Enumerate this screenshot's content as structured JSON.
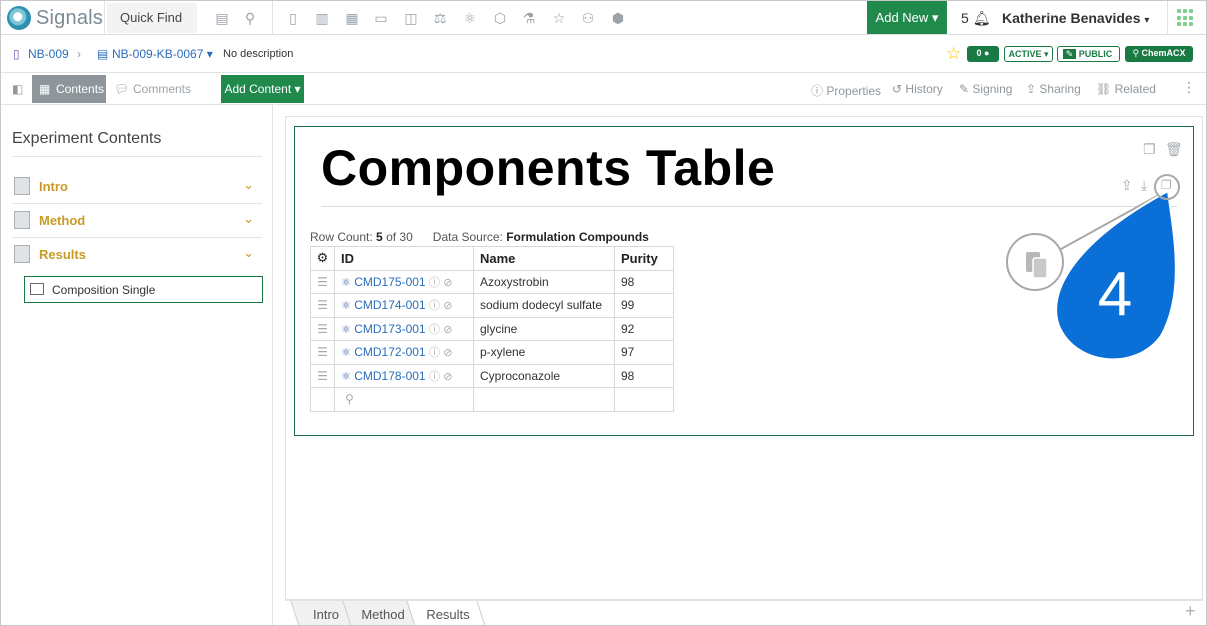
{
  "topbar": {
    "app_name": "Signals",
    "quick_find": "Quick Find",
    "add_new": "Add New",
    "notification_count": "5",
    "user_name": "Katherine Benavides"
  },
  "breadcrumb": {
    "notebook": "NB-009",
    "experiment": "NB-009-KB-0067",
    "description": "No description",
    "comment_count": "0",
    "status": "ACTIVE",
    "visibility": "PUBLIC",
    "chemacx": "ChemACX"
  },
  "toolbar": {
    "contents": "Contents",
    "comments": "Comments",
    "add_content": "Add Content",
    "properties": "Properties",
    "history": "History",
    "signing": "Signing",
    "sharing": "Sharing",
    "related": "Related"
  },
  "sidebar": {
    "title": "Experiment Contents",
    "sections": [
      {
        "label": "Intro"
      },
      {
        "label": "Method"
      },
      {
        "label": "Results"
      }
    ],
    "active_item": "Composition Single"
  },
  "main": {
    "title": "Components Table",
    "row_count_label": "Row Count:",
    "row_count_shown": "5",
    "row_count_total": "of 30",
    "data_source_label": "Data Source:",
    "data_source": "Formulation Compounds",
    "columns": [
      "ID",
      "Name",
      "Purity"
    ],
    "rows": [
      {
        "id": "CMD175-001",
        "name": "Azoxystrobin",
        "purity": "98"
      },
      {
        "id": "CMD174-001",
        "name": "sodium dodecyl sulfate",
        "purity": "99"
      },
      {
        "id": "CMD173-001",
        "name": "glycine",
        "purity": "92"
      },
      {
        "id": "CMD172-001",
        "name": "p-xylene",
        "purity": "97"
      },
      {
        "id": "CMD178-001",
        "name": "Cyproconazole",
        "purity": "98"
      }
    ]
  },
  "callout": {
    "step": "4",
    "color": "#0a6fd6"
  },
  "bottom_tabs": [
    "Intro",
    "Method",
    "Results"
  ]
}
